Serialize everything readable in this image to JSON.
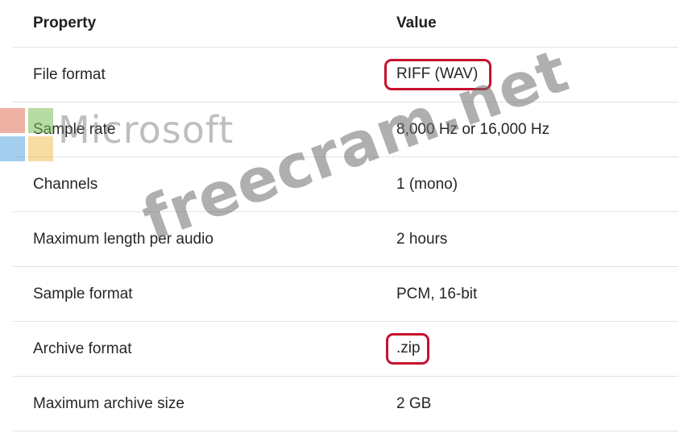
{
  "table": {
    "headers": {
      "property": "Property",
      "value": "Value"
    },
    "rows": [
      {
        "property": "File format",
        "value": "RIFF (WAV)",
        "highlighted": true
      },
      {
        "property": "Sample rate",
        "value": "8,000 Hz or 16,000 Hz",
        "highlighted": false
      },
      {
        "property": "Channels",
        "value": "1 (mono)",
        "highlighted": false
      },
      {
        "property": "Maximum length per audio",
        "value": "2 hours",
        "highlighted": false
      },
      {
        "property": "Sample format",
        "value": "PCM, 16-bit",
        "highlighted": false
      },
      {
        "property": "Archive format",
        "value": ".zip",
        "highlighted": true
      },
      {
        "property": "Maximum archive size",
        "value": "2 GB",
        "highlighted": false
      }
    ]
  },
  "watermark": {
    "brand_text": "Microsoft",
    "site_text": "freecram.net"
  },
  "colors": {
    "highlight_border": "#c8102e",
    "row_divider": "#e3e3e3",
    "text": "#262626"
  }
}
